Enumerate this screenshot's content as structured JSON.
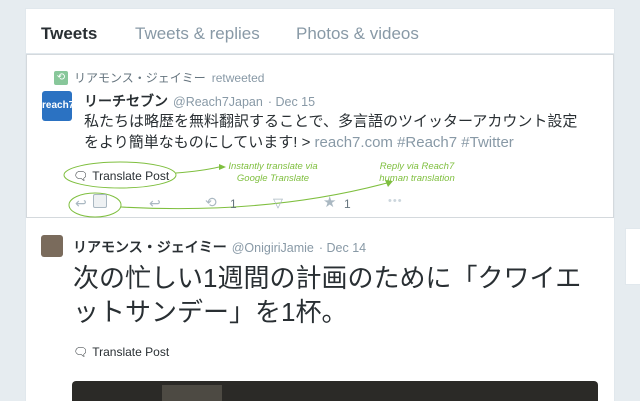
{
  "tabs": [
    "Tweets",
    "Tweets & replies",
    "Photos & videos"
  ],
  "tweet1": {
    "retweeter": "リアモンス・ジェイミー",
    "retweeted_label": "retweeted",
    "avatar_text": "reach7",
    "display_name": "リーチセブン",
    "handle": "@Reach7Japan",
    "date": "· Dec 15",
    "text_line1": "私たちは略歴を無料翻訳することで、多言語のツイッターアカウント設定",
    "text_line2": "をより簡単なものにしています! >",
    "link": "reach7.com #Reach7 #Twitter",
    "translate_label": "Translate Post",
    "anno1_l1": "Instantly translate via",
    "anno1_l2": "Google Translate",
    "anno2_l1": "Reply via Reach7",
    "anno2_l2": "human translation",
    "retweet_count": "1",
    "favorite_count": "1",
    "more": "•••"
  },
  "tweet2": {
    "display_name": "リアモンス・ジェイミー",
    "handle": "@OnigiriJamie",
    "date": "· Dec 14",
    "text": "次の忙しい1週間の計画のために「クワイエットサンデー」を1杯。",
    "translate_label": "Translate Post"
  },
  "icons": [
    "retweet-icon",
    "reply-icon",
    "favorite-icon",
    "pocket-icon",
    "star-icon",
    "more-icon",
    "speech-bubble-icon",
    "reach7-reply-icon"
  ],
  "colors": {
    "annotation": "#7fbf3f",
    "muted": "#8899a6",
    "retweet": "#88c79a"
  }
}
